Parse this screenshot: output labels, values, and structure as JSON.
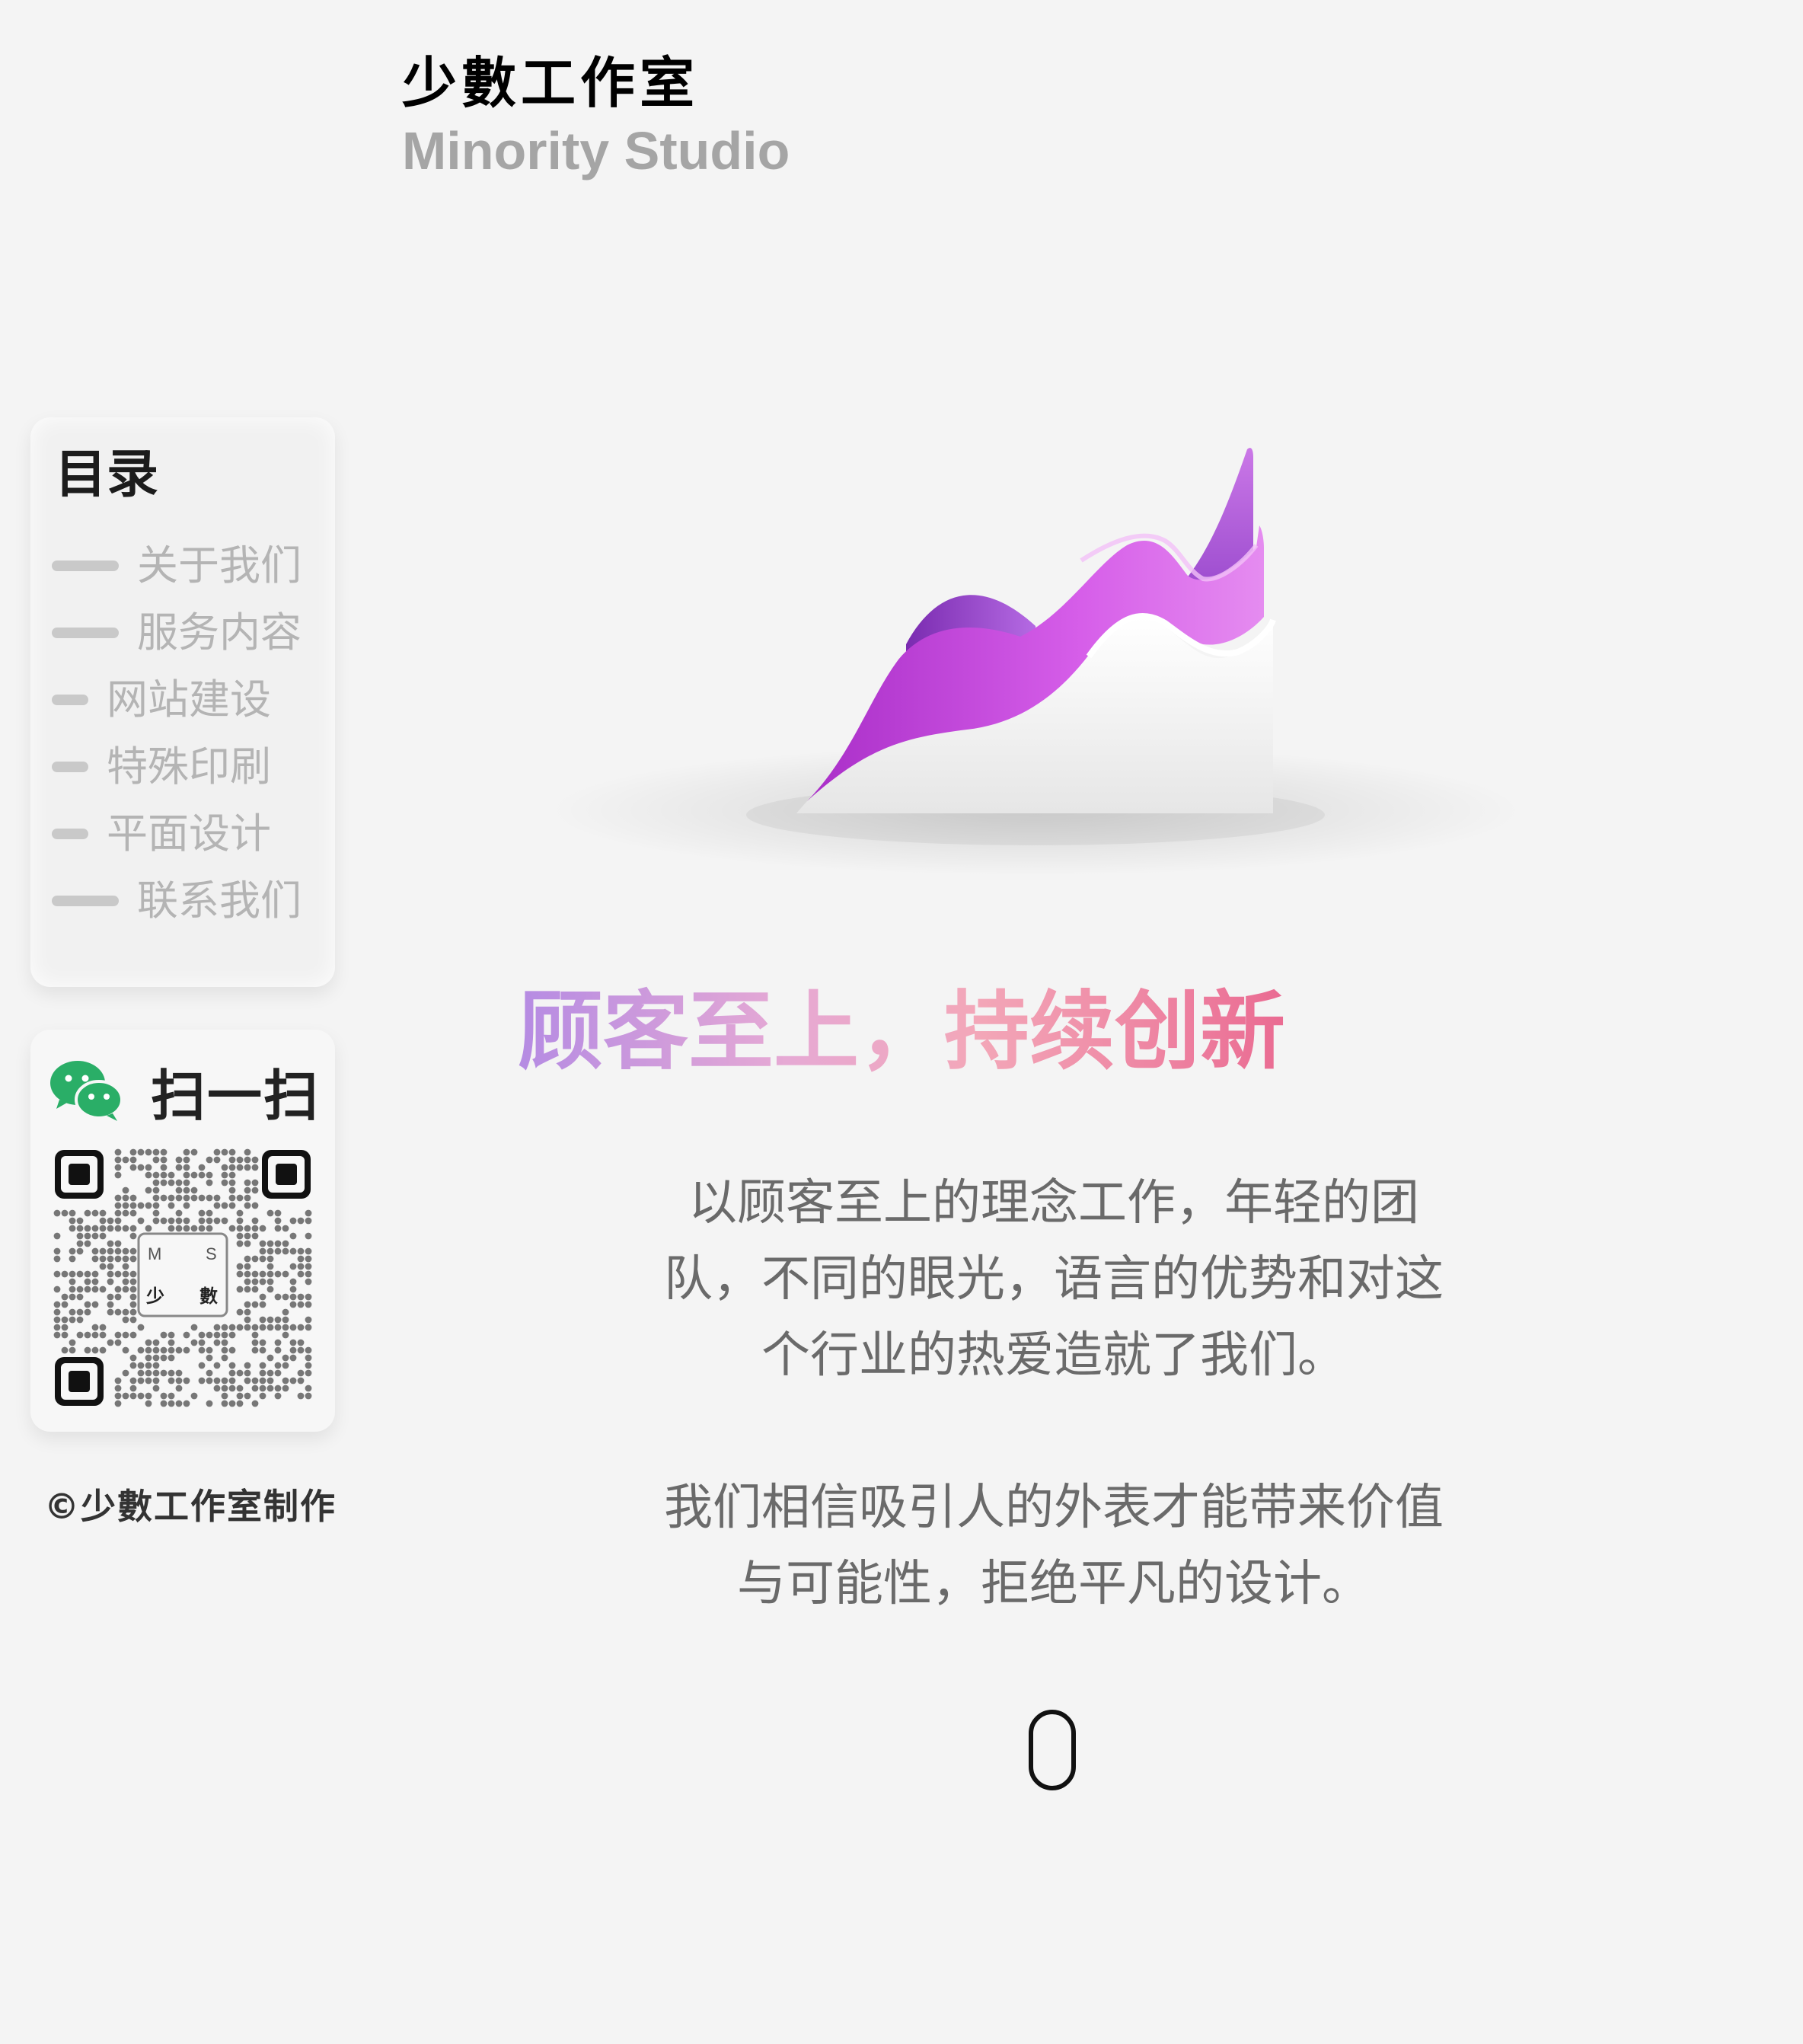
{
  "brand": {
    "name_cn": "少數工作室",
    "name_en": "Minority Studio"
  },
  "toc": {
    "title": "目录",
    "items": [
      {
        "label": "关于我们"
      },
      {
        "label": "服务内容"
      },
      {
        "label": "网站建设"
      },
      {
        "label": "特殊印刷"
      },
      {
        "label": "平面设计"
      },
      {
        "label": "联系我们"
      }
    ]
  },
  "qr": {
    "title": "扫一扫",
    "logo_letters": [
      "M",
      "S",
      "少",
      "數"
    ]
  },
  "copyright": "©少數工作室制作",
  "hero": {
    "headline": "顾客至上，持续创新",
    "paragraph1_lines": [
      "以顾客至上的理念工作，年轻的团",
      "队，不同的眼光，语言的优势和对这",
      "个行业的热爱造就了我们。"
    ],
    "paragraph2_lines": [
      "我们相信吸引人的外表才能带来价值",
      "与可能性，拒绝平凡的设计。"
    ]
  },
  "colors": {
    "background": "#f4f4f4",
    "accent_purple": "#c04ce0",
    "headline_gradient_start": "#b58be3",
    "headline_gradient_end": "#ea6b92",
    "wechat_green": "#2aae67"
  },
  "icons": {
    "wechat": "wechat-icon",
    "scroll": "mouse-scroll-icon",
    "illustration": "area-chart-illustration"
  }
}
